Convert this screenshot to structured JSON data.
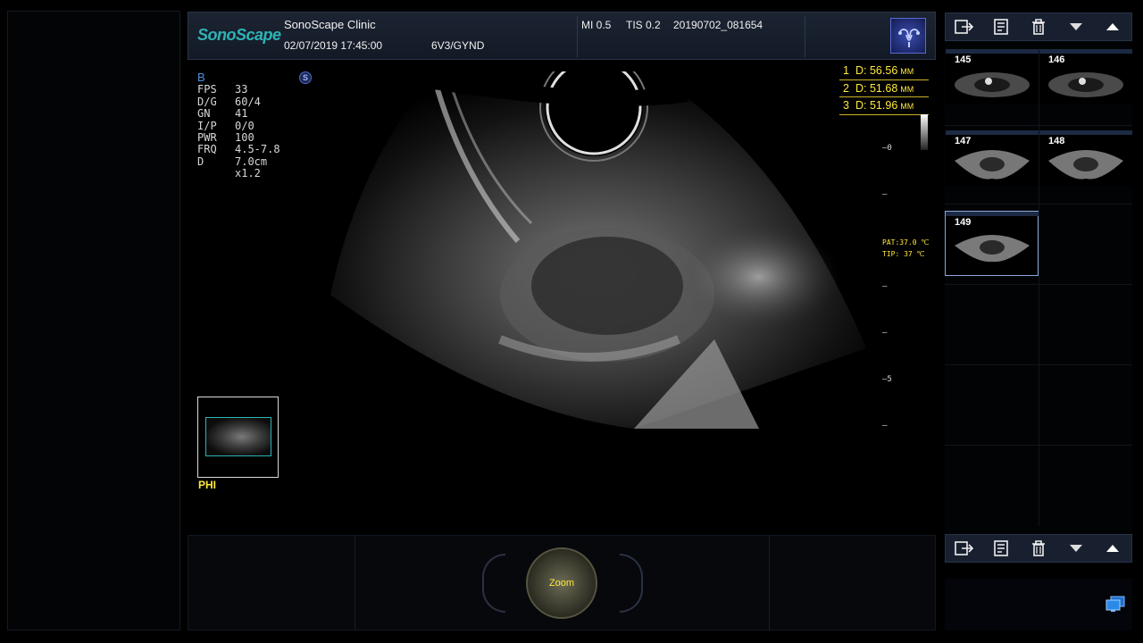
{
  "header": {
    "brand": "SonoScape",
    "clinic": "SonoScape Clinic",
    "datetime": "02/07/2019 17:45:00",
    "probe_preset": "6V3/GYND",
    "mi": "MI  0.5",
    "tis": "TIS 0.2",
    "file_id": "20190702_081654",
    "preset_icon": "uterus-icon"
  },
  "params": {
    "mode": "B",
    "rows": [
      {
        "k": "FPS",
        "v": "33"
      },
      {
        "k": "D/G",
        "v": "60/4"
      },
      {
        "k": "GN",
        "v": "41"
      },
      {
        "k": "I/P",
        "v": "0/0"
      },
      {
        "k": "PWR",
        "v": "100"
      },
      {
        "k": "FRQ",
        "v": "4.5-7.8"
      },
      {
        "k": "D",
        "v": "7.0cm"
      },
      {
        "k": "",
        "v": "x1.2"
      }
    ]
  },
  "measurements": [
    {
      "idx": "1",
      "label": "D:",
      "value": "56.56",
      "unit": "MM"
    },
    {
      "idx": "2",
      "label": "D:",
      "value": "51.68",
      "unit": "MM"
    },
    {
      "idx": "3",
      "label": "D:",
      "value": "51.96",
      "unit": "MM"
    }
  ],
  "depth_scale": {
    "zero": "0",
    "five": "5"
  },
  "temperature": {
    "pat": "PAT:37.0 ℃",
    "tip": "TIP:  37  ℃"
  },
  "phi_label": "PHI",
  "zoom_label": "Zoom",
  "thumbnails": [
    {
      "num": "145"
    },
    {
      "num": "146"
    },
    {
      "num": "147"
    },
    {
      "num": "148"
    },
    {
      "num": "149"
    }
  ],
  "toolbar_icons": [
    "export-icon",
    "report-icon",
    "trash-icon",
    "arrow-down-icon",
    "arrow-up-icon"
  ],
  "colors": {
    "accent": "#2fb3b6",
    "measure": "#ffe93b",
    "mode": "#4f8fe0"
  }
}
